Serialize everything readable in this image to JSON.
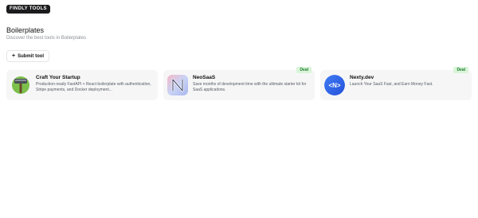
{
  "brand": {
    "label": "FINDLY TOOLS"
  },
  "page": {
    "title": "Boilerplates",
    "subtitle": "Discover the best tools in Boilerplates",
    "submit_label": "Submit tool",
    "submit_icon": "plus-icon"
  },
  "cards": [
    {
      "name": "Craft Your Startup",
      "description": "Production-ready FastAPI + React boilerplate with authentication, Stripe payments, and Docker deployment...",
      "badge": "",
      "logo_icon": "hammer-icon"
    },
    {
      "name": "NeoSaaS",
      "description": "Save months of development time with the ultimate starter kit for SaaS applications.",
      "badge": "Deal",
      "logo_icon": "neosaas-n-icon"
    },
    {
      "name": "Nexty.dev",
      "description": "Launch Your SaaS Fast, and Earn Money Fast.",
      "badge": "Deal",
      "logo_icon": "nexty-code-icon",
      "logo_text": "<N>"
    }
  ],
  "colors": {
    "deal_bg": "#d9f5d8",
    "deal_text": "#1f7a2e",
    "card_bg": "#f6f6f7",
    "nexty_blue": "#2f6df2"
  }
}
